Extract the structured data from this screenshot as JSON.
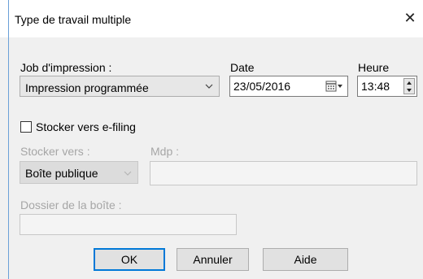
{
  "window": {
    "title": "Type de travail multiple"
  },
  "job": {
    "label": "Job d'impression :",
    "value": "Impression programmée"
  },
  "date": {
    "label": "Date",
    "value": "23/05/2016"
  },
  "time": {
    "label": "Heure",
    "value": "13:48"
  },
  "efiling": {
    "checkbox_label": "Stocker vers e-filing",
    "checked": false,
    "store_to_label": "Stocker vers :",
    "store_to_value": "Boîte publique",
    "password_label": "Mdp :",
    "password_value": "",
    "folder_label": "Dossier de la boîte :",
    "folder_value": ""
  },
  "buttons": {
    "ok": "OK",
    "cancel": "Annuler",
    "help": "Aide"
  },
  "colors": {
    "accent": "#0078d7",
    "dialog_bg": "#f0f0f0",
    "disabled_text": "#a6a6a6"
  }
}
